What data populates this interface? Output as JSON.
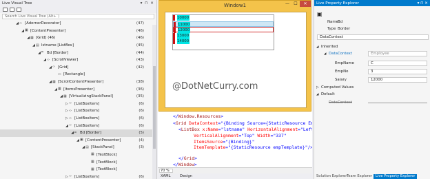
{
  "lvt": {
    "title": "Live Visual Tree",
    "header_icons": "▾ ⊓ ✕",
    "search_placeholder": "Search Live Visual Tree (Alt+`)",
    "rows": [
      {
        "label": "[AdornerDecorator]",
        "count": "(47)"
      },
      {
        "label": "[ContentPresenter]",
        "count": "(46)"
      },
      {
        "label": "[Grid] (46)",
        "count": "(46)"
      },
      {
        "label": "lstname [ListBox]",
        "count": "(45)"
      },
      {
        "label": "Bd [Border]",
        "count": "(44)"
      },
      {
        "label": "[ScrollViewer]",
        "count": "(43)"
      },
      {
        "label": "[Grid]",
        "count": "(42)"
      },
      {
        "label": "[Rectangle]",
        "count": ""
      },
      {
        "label": "[ScrollContentPresenter]",
        "count": "(38)"
      },
      {
        "label": "[ItemsPresenter]",
        "count": "(36)"
      },
      {
        "label": "[VirtualizingStackPanel]",
        "count": "(35)"
      },
      {
        "label": "[ListBoxItem]",
        "count": "(6)"
      },
      {
        "label": "[ListBoxItem]",
        "count": "(6)"
      },
      {
        "label": "[ListBoxItem]",
        "count": "(6)"
      },
      {
        "label": "[ListBoxItem]",
        "count": "(6)"
      },
      {
        "label": "Bd [Border]",
        "count": "(5)"
      },
      {
        "label": "[ContentPresenter]",
        "count": "(4)"
      },
      {
        "label": "[StackPanel]",
        "count": "(3)"
      },
      {
        "label": "[TextBlock]",
        "count": ""
      },
      {
        "label": "[TextBlock]",
        "count": ""
      },
      {
        "label": "[TextBlock]",
        "count": ""
      },
      {
        "label": "[ListBoxItem]",
        "count": "(6)"
      }
    ]
  },
  "window1": {
    "title": "Window1",
    "min": "—",
    "max": "☐",
    "close": "✕",
    "items": [
      "10000",
      "11000",
      "12000",
      "13000",
      "14000"
    ],
    "watermark": "@DotNetCurry.com"
  },
  "editor": {
    "lines": [
      [
        "</",
        "Window.Resources",
        ">"
      ],
      [
        "<",
        "Grid",
        " DataContext",
        "=\"{Binding Source={StaticResource Emps}}\""
      ],
      [
        "<",
        "ListBox",
        " x:Name",
        "=\"lstname\"",
        " HorizontalAlignment",
        "=\"Left\"",
        " Heig"
      ],
      [
        "",
        "",
        " VerticalAlignment",
        "=\"Top\"",
        " Width",
        "=\"337\""
      ],
      [
        "",
        "",
        " ItemsSource",
        "=\"{Binding}\""
      ],
      [
        "",
        "",
        " ItemTemplate",
        "=\"{StaticResource empTemplate}\"/>"
      ],
      [
        "</",
        "Grid",
        ">"
      ],
      [
        "</",
        "Window",
        ">"
      ]
    ],
    "zoom": "70 %",
    "tab_xaml": "XAML",
    "tab_design": "Design"
  },
  "lpe": {
    "title": "Live Property Explorer",
    "header_icons": "▾ ⊓ ✕",
    "name_label": "Name",
    "name_value": "Bd",
    "type_label": "Type",
    "type_value": "Border",
    "datacontext_field": "DataContext",
    "inherited": "Inherited",
    "dc_label": "DataContext",
    "dc_value": "Employee",
    "empname_label": "EmpName",
    "empname_value": "C",
    "empno_label": "EmpNo",
    "empno_value": "3",
    "salary_label": "Salary",
    "salary_value": "12000",
    "computed": "Computed Values",
    "default": "Default",
    "default_dc": "DataContext"
  },
  "bottom_tabs": [
    "Solution Explorer",
    "Team Explorer",
    "Live Property Explorer"
  ]
}
